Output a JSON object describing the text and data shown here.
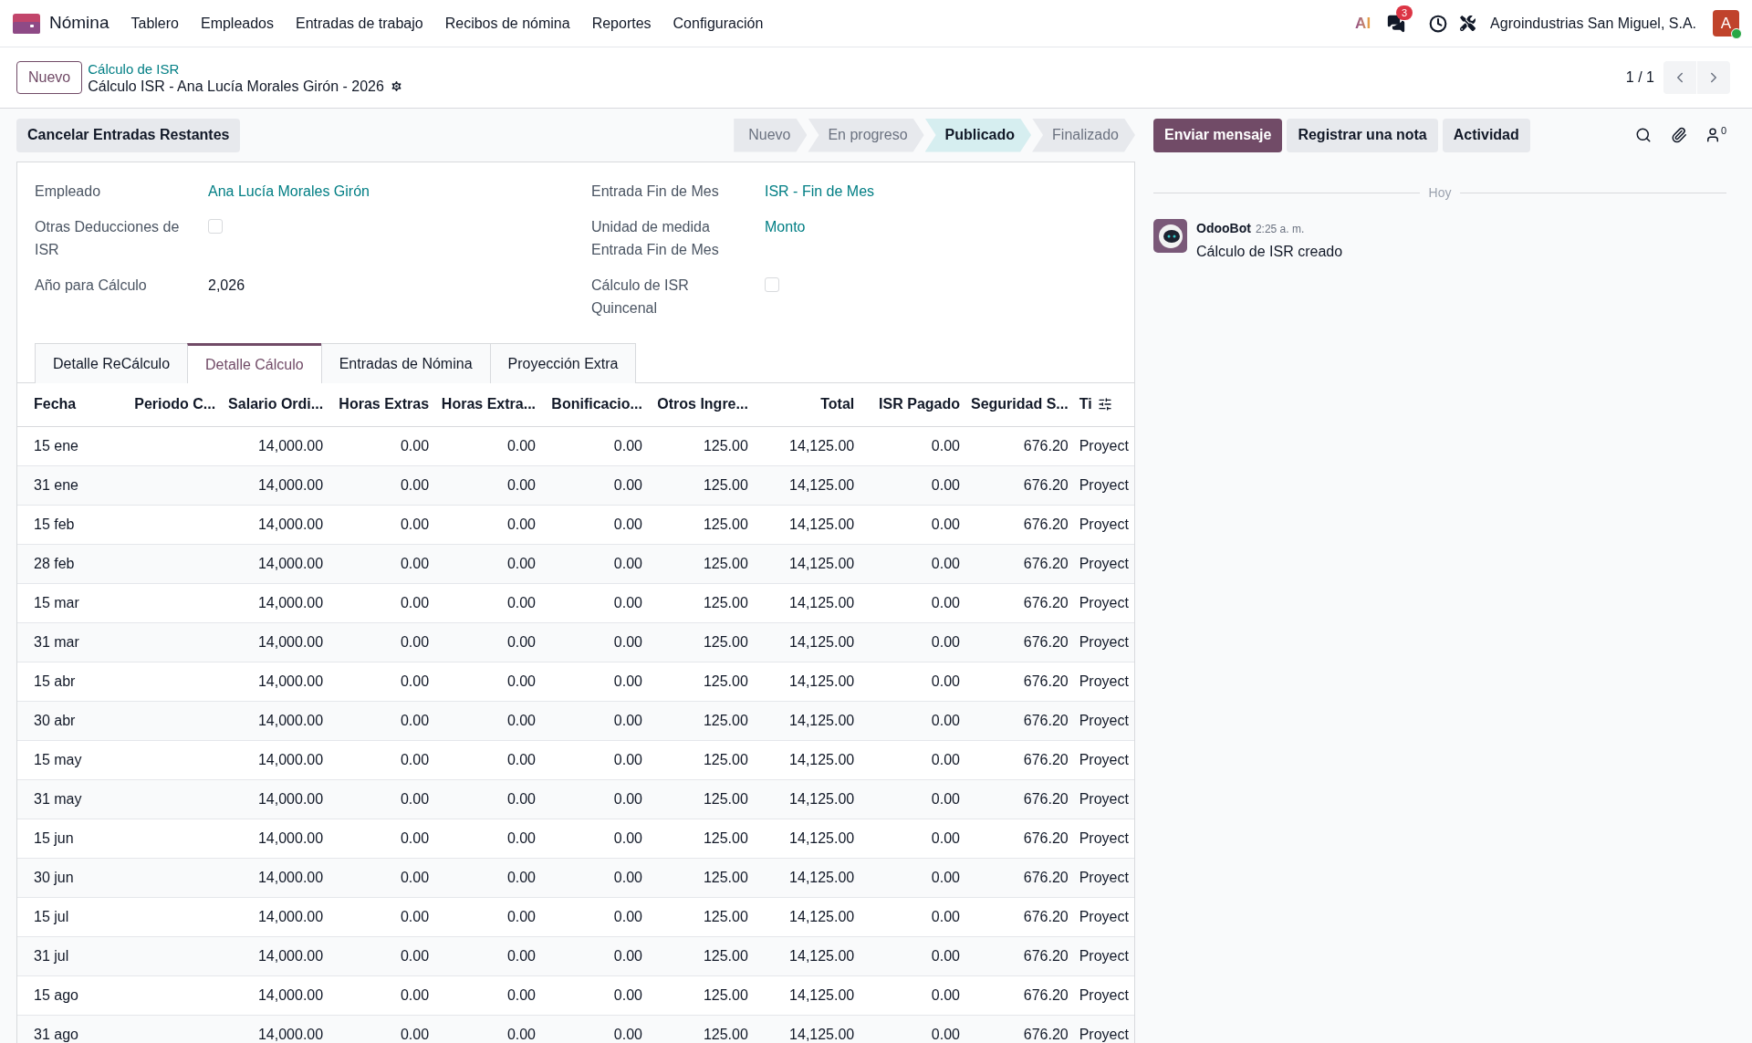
{
  "navbar": {
    "app_name": "Nómina",
    "menu": [
      "Tablero",
      "Empleados",
      "Entradas de trabajo",
      "Recibos de nómina",
      "Reportes",
      "Configuración"
    ],
    "ai_label": "AI",
    "messages_badge": "3",
    "company": "Agroindustrias San Miguel, S.A.",
    "avatar_letter": "A"
  },
  "control_panel": {
    "new_button": "Nuevo",
    "breadcrumb": "Cálculo de ISR",
    "title": "Cálculo ISR - Ana Lucía Morales Girón - 2026",
    "pager": "1 / 1"
  },
  "action_button": "Cancelar Entradas Restantes",
  "stages": [
    {
      "label": "Nuevo",
      "selected": false
    },
    {
      "label": "En progreso",
      "selected": false
    },
    {
      "label": "Publicado",
      "selected": true
    },
    {
      "label": "Finalizado",
      "selected": false
    }
  ],
  "fields_left": [
    {
      "kind": "link",
      "label": "Empleado",
      "value": "Ana Lucía Morales Girón"
    },
    {
      "kind": "checkbox",
      "label": "Otras Deducciones de ISR",
      "checked": false
    },
    {
      "kind": "text",
      "label": "Año para Cálculo",
      "value": "2,026"
    }
  ],
  "fields_right": [
    {
      "kind": "link",
      "label": "Entrada Fin de Mes",
      "value": "ISR - Fin de Mes"
    },
    {
      "kind": "link",
      "label": "Unidad de medida Entrada Fin de Mes",
      "value": "Monto"
    },
    {
      "kind": "checkbox",
      "label": "Cálculo de ISR Quincenal",
      "checked": false
    }
  ],
  "tabs": [
    {
      "label": "Detalle ReCálculo",
      "selected": false
    },
    {
      "label": "Detalle Cálculo",
      "selected": true
    },
    {
      "label": "Entradas de Nómina",
      "selected": false
    },
    {
      "label": "Proyección Extra",
      "selected": false
    }
  ],
  "table": {
    "columns": [
      "Fecha",
      "Periodo C...",
      "Salario Ordi...",
      "Horas Extras",
      "Horas Extra...",
      "Bonificacio...",
      "Otros Ingre...",
      "Total",
      "ISR Pagado",
      "Seguridad S...",
      "Ti"
    ],
    "rows": [
      {
        "fecha": "15 ene",
        "salario": "14,000.00",
        "horas_extras": "0.00",
        "horas_extra_2": "0.00",
        "bonificacion": "0.00",
        "otros": "125.00",
        "total": "14,125.00",
        "isr": "0.00",
        "seguridad": "676.20",
        "tipo": "Proyect"
      },
      {
        "fecha": "31 ene",
        "salario": "14,000.00",
        "horas_extras": "0.00",
        "horas_extra_2": "0.00",
        "bonificacion": "0.00",
        "otros": "125.00",
        "total": "14,125.00",
        "isr": "0.00",
        "seguridad": "676.20",
        "tipo": "Proyect"
      },
      {
        "fecha": "15 feb",
        "salario": "14,000.00",
        "horas_extras": "0.00",
        "horas_extra_2": "0.00",
        "bonificacion": "0.00",
        "otros": "125.00",
        "total": "14,125.00",
        "isr": "0.00",
        "seguridad": "676.20",
        "tipo": "Proyect"
      },
      {
        "fecha": "28 feb",
        "salario": "14,000.00",
        "horas_extras": "0.00",
        "horas_extra_2": "0.00",
        "bonificacion": "0.00",
        "otros": "125.00",
        "total": "14,125.00",
        "isr": "0.00",
        "seguridad": "676.20",
        "tipo": "Proyect"
      },
      {
        "fecha": "15 mar",
        "salario": "14,000.00",
        "horas_extras": "0.00",
        "horas_extra_2": "0.00",
        "bonificacion": "0.00",
        "otros": "125.00",
        "total": "14,125.00",
        "isr": "0.00",
        "seguridad": "676.20",
        "tipo": "Proyect"
      },
      {
        "fecha": "31 mar",
        "salario": "14,000.00",
        "horas_extras": "0.00",
        "horas_extra_2": "0.00",
        "bonificacion": "0.00",
        "otros": "125.00",
        "total": "14,125.00",
        "isr": "0.00",
        "seguridad": "676.20",
        "tipo": "Proyect"
      },
      {
        "fecha": "15 abr",
        "salario": "14,000.00",
        "horas_extras": "0.00",
        "horas_extra_2": "0.00",
        "bonificacion": "0.00",
        "otros": "125.00",
        "total": "14,125.00",
        "isr": "0.00",
        "seguridad": "676.20",
        "tipo": "Proyect"
      },
      {
        "fecha": "30 abr",
        "salario": "14,000.00",
        "horas_extras": "0.00",
        "horas_extra_2": "0.00",
        "bonificacion": "0.00",
        "otros": "125.00",
        "total": "14,125.00",
        "isr": "0.00",
        "seguridad": "676.20",
        "tipo": "Proyect"
      },
      {
        "fecha": "15 may",
        "salario": "14,000.00",
        "horas_extras": "0.00",
        "horas_extra_2": "0.00",
        "bonificacion": "0.00",
        "otros": "125.00",
        "total": "14,125.00",
        "isr": "0.00",
        "seguridad": "676.20",
        "tipo": "Proyect"
      },
      {
        "fecha": "31 may",
        "salario": "14,000.00",
        "horas_extras": "0.00",
        "horas_extra_2": "0.00",
        "bonificacion": "0.00",
        "otros": "125.00",
        "total": "14,125.00",
        "isr": "0.00",
        "seguridad": "676.20",
        "tipo": "Proyect"
      },
      {
        "fecha": "15 jun",
        "salario": "14,000.00",
        "horas_extras": "0.00",
        "horas_extra_2": "0.00",
        "bonificacion": "0.00",
        "otros": "125.00",
        "total": "14,125.00",
        "isr": "0.00",
        "seguridad": "676.20",
        "tipo": "Proyect"
      },
      {
        "fecha": "30 jun",
        "salario": "14,000.00",
        "horas_extras": "0.00",
        "horas_extra_2": "0.00",
        "bonificacion": "0.00",
        "otros": "125.00",
        "total": "14,125.00",
        "isr": "0.00",
        "seguridad": "676.20",
        "tipo": "Proyect"
      },
      {
        "fecha": "15 jul",
        "salario": "14,000.00",
        "horas_extras": "0.00",
        "horas_extra_2": "0.00",
        "bonificacion": "0.00",
        "otros": "125.00",
        "total": "14,125.00",
        "isr": "0.00",
        "seguridad": "676.20",
        "tipo": "Proyect"
      },
      {
        "fecha": "31 jul",
        "salario": "14,000.00",
        "horas_extras": "0.00",
        "horas_extra_2": "0.00",
        "bonificacion": "0.00",
        "otros": "125.00",
        "total": "14,125.00",
        "isr": "0.00",
        "seguridad": "676.20",
        "tipo": "Proyect"
      },
      {
        "fecha": "15 ago",
        "salario": "14,000.00",
        "horas_extras": "0.00",
        "horas_extra_2": "0.00",
        "bonificacion": "0.00",
        "otros": "125.00",
        "total": "14,125.00",
        "isr": "0.00",
        "seguridad": "676.20",
        "tipo": "Proyect"
      },
      {
        "fecha": "31 ago",
        "salario": "14,000.00",
        "horas_extras": "0.00",
        "horas_extra_2": "0.00",
        "bonificacion": "0.00",
        "otros": "125.00",
        "total": "14,125.00",
        "isr": "0.00",
        "seguridad": "676.20",
        "tipo": "Proyect"
      }
    ]
  },
  "chatter": {
    "buttons": [
      {
        "label": "Enviar mensaje",
        "kind": "primary"
      },
      {
        "label": "Registrar una nota",
        "kind": "secondary"
      },
      {
        "label": "Actividad",
        "kind": "secondary"
      }
    ],
    "followers_count": "0",
    "separator": "Hoy",
    "messages": [
      {
        "author": "OdooBot",
        "time": "2:25 a. m.",
        "body": "Cálculo de ISR creado"
      }
    ]
  }
}
